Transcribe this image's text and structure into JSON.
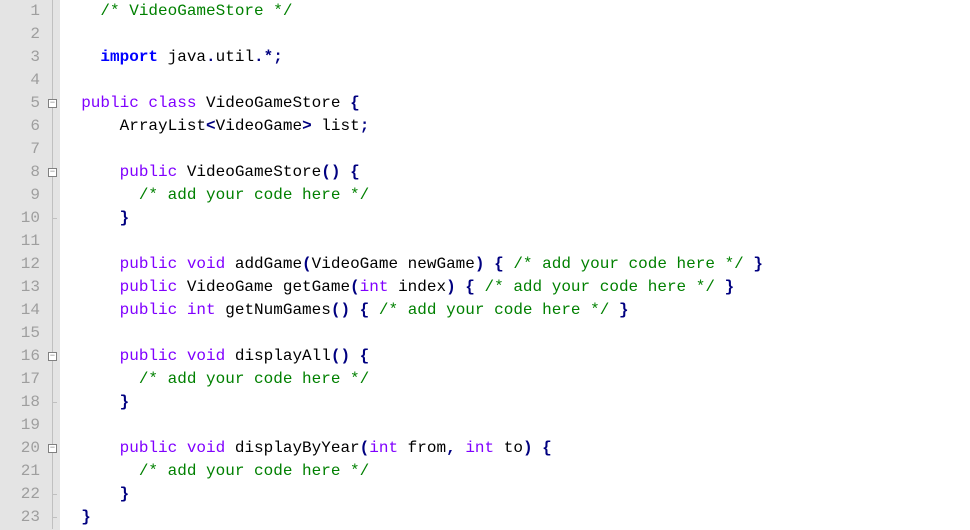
{
  "lines": [
    {
      "n": 1,
      "fold": "line",
      "tokens": [
        {
          "t": "    ",
          "c": ""
        },
        {
          "t": "/* VideoGameStore */",
          "c": "cm"
        }
      ]
    },
    {
      "n": 2,
      "fold": "line",
      "tokens": []
    },
    {
      "n": 3,
      "fold": "line",
      "tokens": [
        {
          "t": "    ",
          "c": ""
        },
        {
          "t": "import",
          "c": "kw"
        },
        {
          "t": " java",
          "c": ""
        },
        {
          "t": ".",
          "c": "op"
        },
        {
          "t": "util",
          "c": ""
        },
        {
          "t": ".*;",
          "c": "op"
        }
      ]
    },
    {
      "n": 4,
      "fold": "line",
      "tokens": []
    },
    {
      "n": 5,
      "fold": "box",
      "tokens": [
        {
          "t": "  ",
          "c": ""
        },
        {
          "t": "public",
          "c": "kw2"
        },
        {
          "t": " ",
          "c": ""
        },
        {
          "t": "class",
          "c": "kw2"
        },
        {
          "t": " VideoGameStore ",
          "c": ""
        },
        {
          "t": "{",
          "c": "op"
        }
      ]
    },
    {
      "n": 6,
      "fold": "line",
      "tokens": [
        {
          "t": "      ArrayList",
          "c": ""
        },
        {
          "t": "<",
          "c": "op"
        },
        {
          "t": "VideoGame",
          "c": ""
        },
        {
          "t": ">",
          "c": "op"
        },
        {
          "t": " list",
          "c": ""
        },
        {
          "t": ";",
          "c": "op"
        }
      ]
    },
    {
      "n": 7,
      "fold": "line",
      "tokens": []
    },
    {
      "n": 8,
      "fold": "box",
      "tokens": [
        {
          "t": "      ",
          "c": ""
        },
        {
          "t": "public",
          "c": "kw2"
        },
        {
          "t": " VideoGameStore",
          "c": ""
        },
        {
          "t": "()",
          "c": "op"
        },
        {
          "t": " ",
          "c": ""
        },
        {
          "t": "{",
          "c": "op"
        }
      ]
    },
    {
      "n": 9,
      "fold": "line",
      "tokens": [
        {
          "t": "        ",
          "c": ""
        },
        {
          "t": "/* add your code here */",
          "c": "cm"
        }
      ]
    },
    {
      "n": 10,
      "fold": "end",
      "tokens": [
        {
          "t": "      ",
          "c": ""
        },
        {
          "t": "}",
          "c": "op"
        }
      ]
    },
    {
      "n": 11,
      "fold": "line",
      "tokens": []
    },
    {
      "n": 12,
      "fold": "line",
      "tokens": [
        {
          "t": "      ",
          "c": ""
        },
        {
          "t": "public",
          "c": "kw2"
        },
        {
          "t": " ",
          "c": ""
        },
        {
          "t": "void",
          "c": "kw2"
        },
        {
          "t": " addGame",
          "c": ""
        },
        {
          "t": "(",
          "c": "op"
        },
        {
          "t": "VideoGame newGame",
          "c": ""
        },
        {
          "t": ")",
          "c": "op"
        },
        {
          "t": " ",
          "c": ""
        },
        {
          "t": "{",
          "c": "op"
        },
        {
          "t": " ",
          "c": ""
        },
        {
          "t": "/* add your code here */",
          "c": "cm"
        },
        {
          "t": " ",
          "c": ""
        },
        {
          "t": "}",
          "c": "op"
        }
      ]
    },
    {
      "n": 13,
      "fold": "line",
      "tokens": [
        {
          "t": "      ",
          "c": ""
        },
        {
          "t": "public",
          "c": "kw2"
        },
        {
          "t": " VideoGame getGame",
          "c": ""
        },
        {
          "t": "(",
          "c": "op"
        },
        {
          "t": "int",
          "c": "kw2"
        },
        {
          "t": " index",
          "c": ""
        },
        {
          "t": ")",
          "c": "op"
        },
        {
          "t": " ",
          "c": ""
        },
        {
          "t": "{",
          "c": "op"
        },
        {
          "t": " ",
          "c": ""
        },
        {
          "t": "/* add your code here */",
          "c": "cm"
        },
        {
          "t": " ",
          "c": ""
        },
        {
          "t": "}",
          "c": "op"
        }
      ]
    },
    {
      "n": 14,
      "fold": "line",
      "tokens": [
        {
          "t": "      ",
          "c": ""
        },
        {
          "t": "public",
          "c": "kw2"
        },
        {
          "t": " ",
          "c": ""
        },
        {
          "t": "int",
          "c": "kw2"
        },
        {
          "t": " getNumGames",
          "c": ""
        },
        {
          "t": "()",
          "c": "op"
        },
        {
          "t": " ",
          "c": ""
        },
        {
          "t": "{",
          "c": "op"
        },
        {
          "t": " ",
          "c": ""
        },
        {
          "t": "/* add your code here */",
          "c": "cm"
        },
        {
          "t": " ",
          "c": ""
        },
        {
          "t": "}",
          "c": "op"
        }
      ]
    },
    {
      "n": 15,
      "fold": "line",
      "tokens": []
    },
    {
      "n": 16,
      "fold": "box",
      "tokens": [
        {
          "t": "      ",
          "c": ""
        },
        {
          "t": "public",
          "c": "kw2"
        },
        {
          "t": " ",
          "c": ""
        },
        {
          "t": "void",
          "c": "kw2"
        },
        {
          "t": " displayAll",
          "c": ""
        },
        {
          "t": "()",
          "c": "op"
        },
        {
          "t": " ",
          "c": ""
        },
        {
          "t": "{",
          "c": "op"
        }
      ]
    },
    {
      "n": 17,
      "fold": "line",
      "tokens": [
        {
          "t": "        ",
          "c": ""
        },
        {
          "t": "/* add your code here */",
          "c": "cm"
        }
      ]
    },
    {
      "n": 18,
      "fold": "end",
      "tokens": [
        {
          "t": "      ",
          "c": ""
        },
        {
          "t": "}",
          "c": "op"
        }
      ]
    },
    {
      "n": 19,
      "fold": "line",
      "tokens": []
    },
    {
      "n": 20,
      "fold": "box",
      "tokens": [
        {
          "t": "      ",
          "c": ""
        },
        {
          "t": "public",
          "c": "kw2"
        },
        {
          "t": " ",
          "c": ""
        },
        {
          "t": "void",
          "c": "kw2"
        },
        {
          "t": " displayByYear",
          "c": ""
        },
        {
          "t": "(",
          "c": "op"
        },
        {
          "t": "int",
          "c": "kw2"
        },
        {
          "t": " from",
          "c": ""
        },
        {
          "t": ",",
          "c": "op"
        },
        {
          "t": " ",
          "c": ""
        },
        {
          "t": "int",
          "c": "kw2"
        },
        {
          "t": " to",
          "c": ""
        },
        {
          "t": ")",
          "c": "op"
        },
        {
          "t": " ",
          "c": ""
        },
        {
          "t": "{",
          "c": "op"
        }
      ]
    },
    {
      "n": 21,
      "fold": "line",
      "tokens": [
        {
          "t": "        ",
          "c": ""
        },
        {
          "t": "/* add your code here */",
          "c": "cm"
        }
      ]
    },
    {
      "n": 22,
      "fold": "end",
      "tokens": [
        {
          "t": "      ",
          "c": ""
        },
        {
          "t": "}",
          "c": "op"
        }
      ]
    },
    {
      "n": 23,
      "fold": "end",
      "tokens": [
        {
          "t": "  ",
          "c": ""
        },
        {
          "t": "}",
          "c": "op"
        }
      ]
    }
  ],
  "foldBoxGlyph": "−"
}
